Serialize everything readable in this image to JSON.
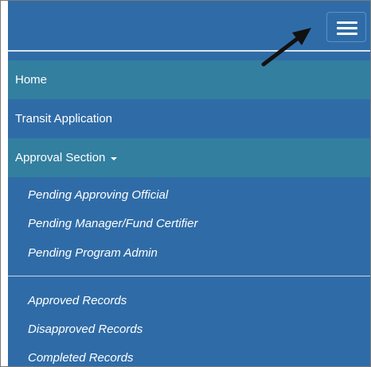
{
  "navbar": {
    "toggle_icon": "hamburger-menu-icon",
    "annotation_icon": "pointer-arrow-icon"
  },
  "menu": {
    "home": "Home",
    "transit_application": "Transit Application",
    "approval_section": "Approval Section",
    "approval_items": [
      "Pending Approving Official",
      "Pending Manager/Fund Certifier",
      "Pending Program Admin"
    ],
    "record_items": [
      "Approved Records",
      "Disapproved Records",
      "Completed Records"
    ]
  },
  "colors": {
    "navbar_bg": "#2f6ca7",
    "active_item_bg": "#337f9f",
    "text": "#ffffff",
    "arrow": "#111111"
  }
}
